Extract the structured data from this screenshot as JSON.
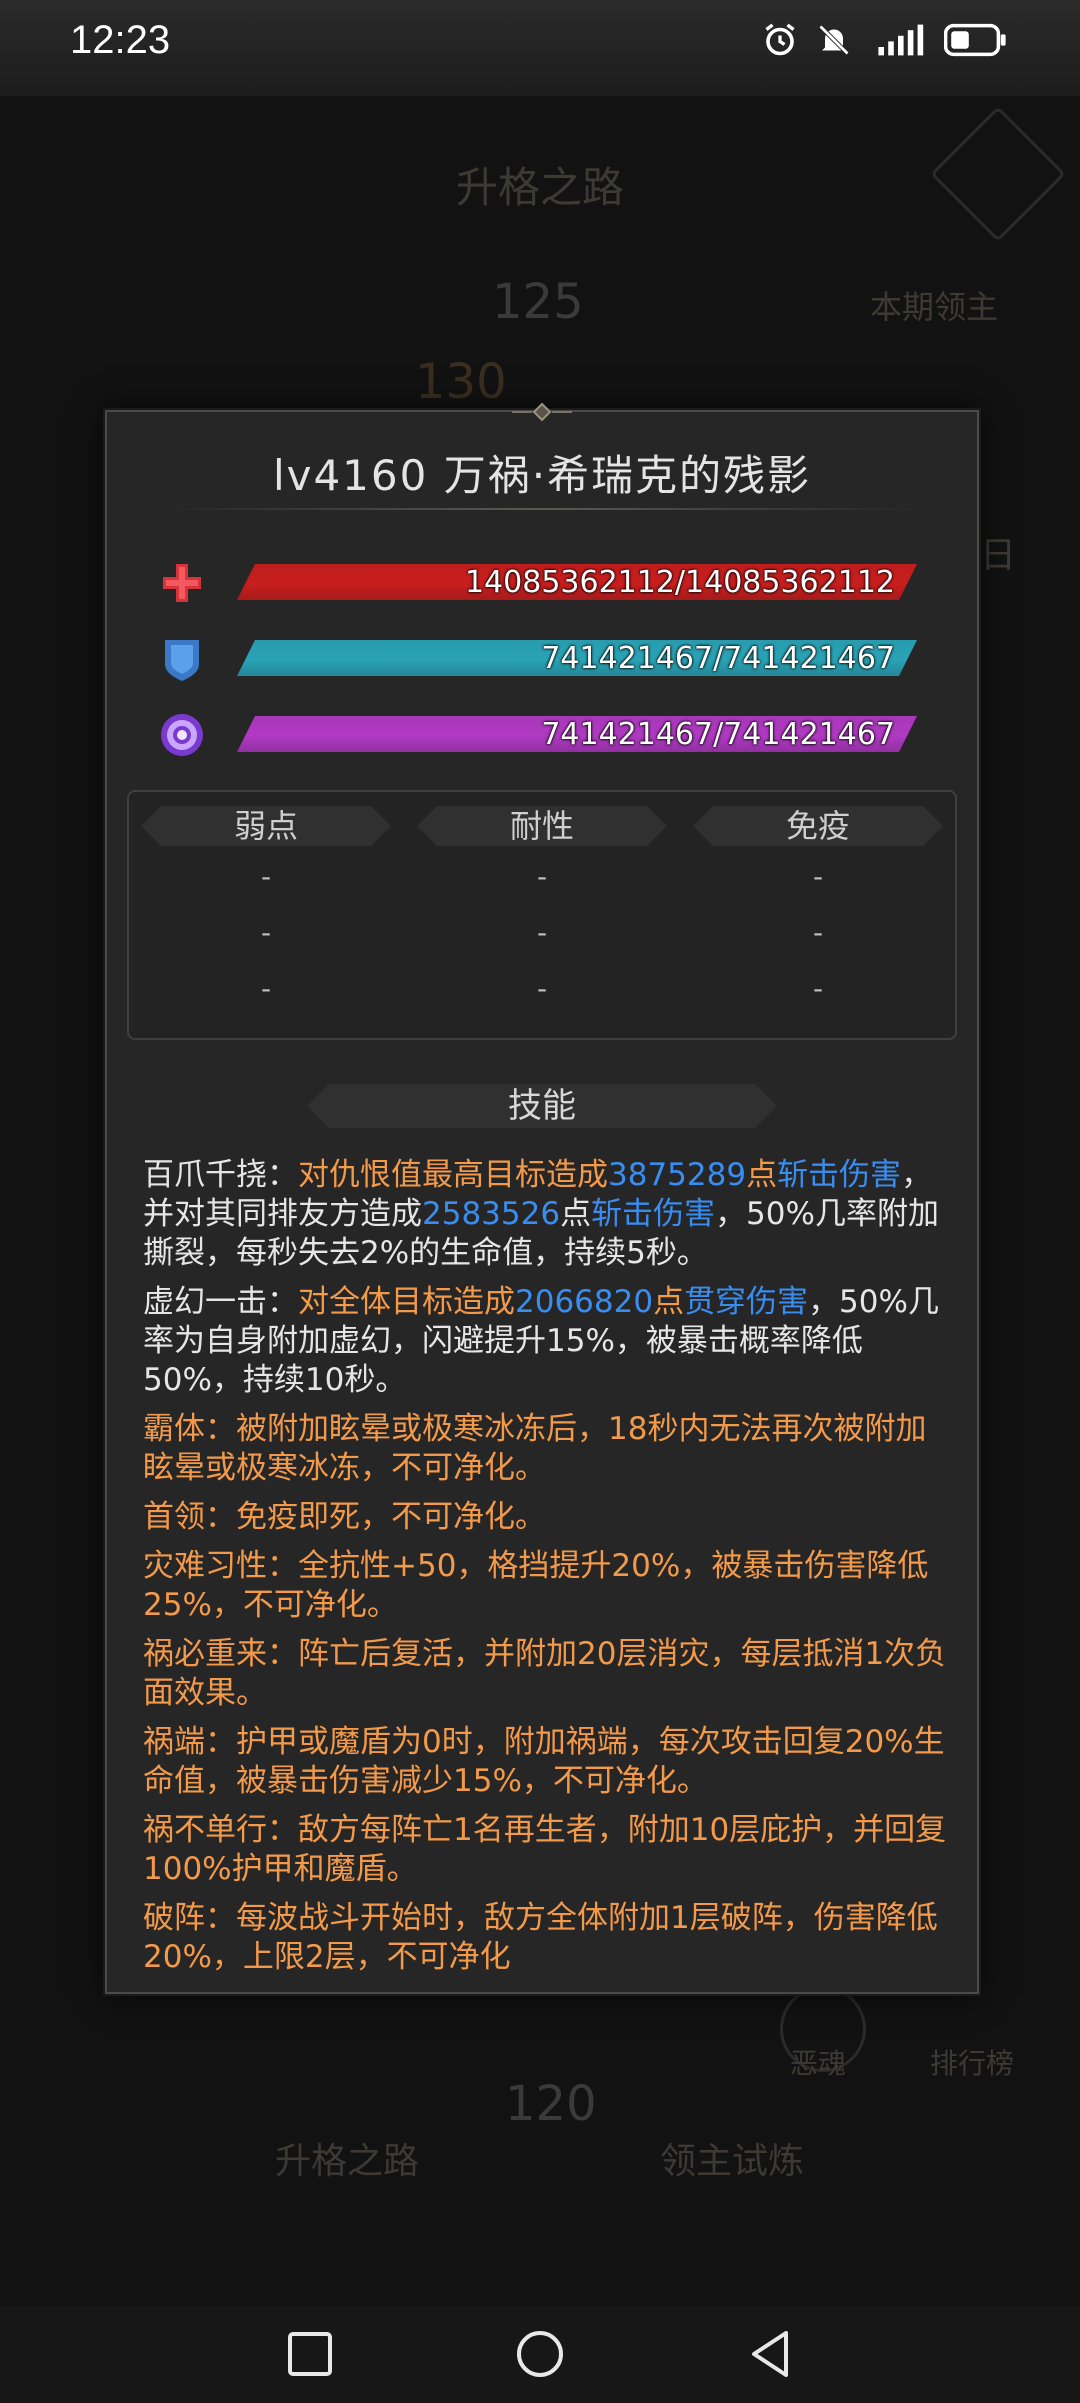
{
  "status_bar": {
    "time": "12:23"
  },
  "background": {
    "title": "升格之路",
    "num_125": "125",
    "num_130": "130",
    "num_120": "120",
    "current_boss": "本期领主",
    "ghost_label": "恶魂",
    "rank_label": "排行榜",
    "tab_path": "升格之路",
    "tab_trial": "领主试炼",
    "side_char": "日"
  },
  "modal": {
    "title": "lv4160 万祸·希瑞克的残影",
    "hp": {
      "text": "14085362112/14085362112",
      "fraction": 1.0,
      "color": "#c81e1e"
    },
    "armor": {
      "text": "741421467/741421467",
      "fraction": 1.0,
      "color": "#2aa3b6"
    },
    "magic": {
      "text": "741421467/741421467",
      "fraction": 1.0,
      "color": "#b03ac2"
    },
    "resist_headers": [
      "弱点",
      "耐性",
      "免疫"
    ],
    "resist_dash": "-",
    "skills_header": "技能",
    "skills": [
      {
        "color": "white",
        "parts": [
          {
            "t": "百爪千挠：",
            "c": "white"
          },
          {
            "t": "对仇恨值最高目标造成",
            "c": "orange"
          },
          {
            "t": "3875289",
            "c": "blue"
          },
          {
            "t": "点",
            "c": "orange"
          },
          {
            "t": "斩击伤害",
            "c": "blue"
          },
          {
            "t": "，并对其同排友方造成",
            "c": "white"
          },
          {
            "t": "2583526",
            "c": "blue"
          },
          {
            "t": "点",
            "c": "white"
          },
          {
            "t": "斩击伤害",
            "c": "blue"
          },
          {
            "t": "，50%几率附加撕裂，每秒失去2%的生命值，持续5秒。",
            "c": "white"
          }
        ]
      },
      {
        "color": "white",
        "parts": [
          {
            "t": "虚幻一击：",
            "c": "white"
          },
          {
            "t": "对全体目标造成",
            "c": "orange"
          },
          {
            "t": "2066820",
            "c": "blue"
          },
          {
            "t": "点",
            "c": "orange"
          },
          {
            "t": "贯穿伤害",
            "c": "blue"
          },
          {
            "t": "，50%几率为自身附加虚幻，闪避提升15%，被暴击概率降低50%，持续10秒。",
            "c": "white"
          }
        ]
      },
      {
        "color": "orange",
        "parts": [
          {
            "t": "霸体：被附加眩晕或极寒冰冻后，18秒内无法再次被附加眩晕或极寒冰冻，不可净化。",
            "c": "orange"
          }
        ]
      },
      {
        "color": "orange",
        "parts": [
          {
            "t": "首领：免疫即死，不可净化。",
            "c": "orange"
          }
        ]
      },
      {
        "color": "orange",
        "parts": [
          {
            "t": "灾难习性：全抗性+50，格挡提升20%，被暴击伤害降低25%，不可净化。",
            "c": "orange"
          }
        ]
      },
      {
        "color": "orange",
        "parts": [
          {
            "t": "祸必重来：阵亡后复活，并附加20层消灾，每层抵消1次负面效果。",
            "c": "orange"
          }
        ]
      },
      {
        "color": "orange",
        "parts": [
          {
            "t": "祸端：护甲或魔盾为0时，附加祸端，每次攻击回复20%生命值，被暴击伤害减少15%，不可净化。",
            "c": "orange"
          }
        ]
      },
      {
        "color": "orange",
        "parts": [
          {
            "t": "祸不单行：敌方每阵亡1名再生者，附加10层庇护，并回复100%护甲和魔盾。",
            "c": "orange"
          }
        ]
      },
      {
        "color": "orange",
        "parts": [
          {
            "t": "破阵：每波战斗开始时，敌方全体附加1层破阵，伤害降低20%，上限2层，不可净化",
            "c": "orange"
          }
        ]
      }
    ]
  }
}
